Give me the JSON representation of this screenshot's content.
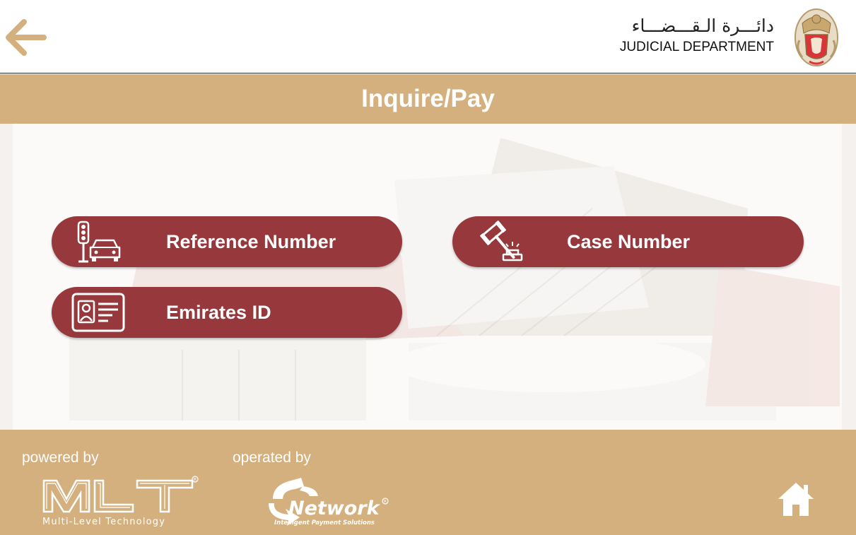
{
  "header": {
    "brand_arabic": "دائـــرة الـقـــضـــاء",
    "brand_english": "JUDICIAL DEPARTMENT"
  },
  "page": {
    "title": "Inquire/Pay"
  },
  "options": [
    {
      "label": "Reference Number",
      "icon": "traffic-light-car-icon"
    },
    {
      "label": "Case Number",
      "icon": "gavel-icon"
    },
    {
      "label": "Emirates ID",
      "icon": "id-card-icon"
    }
  ],
  "footer": {
    "powered_by_label": "powered by",
    "operated_by_label": "operated by",
    "mlt_logo_text": "MLT",
    "mlt_tagline": "Multi-Level Technology",
    "network_logo_text": "Network",
    "network_tagline": "Intelligent Payment Solutions"
  },
  "icons": {
    "back": "back-arrow-icon",
    "home": "home-icon"
  },
  "colors": {
    "accent_gold": "#d4b07f",
    "button_red": "#97393c",
    "back_arrow": "#d4b07f"
  }
}
